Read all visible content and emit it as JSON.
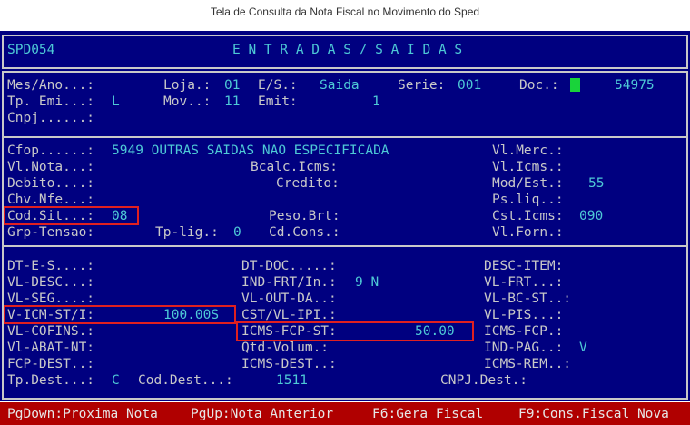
{
  "caption": "Tela de Consulta da Nota Fiscal no Movimento do Sped",
  "header": {
    "program": "SPD054",
    "title": "E N T R A D A S / S A I D A S"
  },
  "section1": {
    "mes_ano": "Mes/Ano...:",
    "loja_label": "Loja.:",
    "loja_value": "01",
    "es_label": "E/S.:",
    "es_value": "Saida",
    "serie_label": "Serie:",
    "serie_value": "001",
    "doc_label": "Doc.:",
    "doc_value": "54975",
    "tp_emi_label": "Tp. Emi...:",
    "tp_emi_value": "L",
    "mov_label": "Mov..:",
    "mov_value": "11",
    "emit_label": "Emit:",
    "emit_value": "1",
    "cnpj_label": "Cnpj......:"
  },
  "section2": {
    "cfop_label": "Cfop......:",
    "cfop_value": "5949 OUTRAS SAIDAS NAO ESPECIFICADA",
    "vl_merc": "Vl.Merc.:",
    "vl_nota": "Vl.Nota...:",
    "bcalc_icms": "Bcalc.Icms:",
    "vl_icms": "Vl.Icms.:",
    "debito": "Debito....:",
    "credito": "Credito:",
    "mod_est_label": "Mod/Est.:",
    "mod_est_value": "55",
    "chv_nfe": "Chv.Nfe...:",
    "ps_liq": "Ps.liq..:",
    "cod_sit_label": "Cod.Sit...:",
    "cod_sit_value": "08",
    "peso_brt": "Peso.Brt:",
    "cst_icms_label": "Cst.Icms:",
    "cst_icms_value": "090",
    "grp_tensao": "Grp-Tensao:",
    "tp_lig_label": "Tp-lig.:",
    "tp_lig_value": "0",
    "cd_cons": "Cd.Cons.:",
    "vl_forn": "Vl.Forn.:"
  },
  "section3": {
    "dt_e_s": "DT-E-S....:",
    "dt_doc": "DT-DOC.....:",
    "desc_item": "DESC-ITEM:",
    "vl_desc": "VL-DESC...:",
    "ind_frt_label": "IND-FRT/In.:",
    "ind_frt_value": "9 N",
    "vl_frt": "VL-FRT...:",
    "vl_seg": "VL-SEG....:",
    "vl_out_da": "VL-OUT-DA..:",
    "vl_bc_st": "VL-BC-ST..:",
    "v_icm_st_label": "V-ICM-ST/I:",
    "v_icm_st_value": "100.00S",
    "cst_vl_ipi": "CST/VL-IPI.:",
    "vl_pis": "VL-PIS...:",
    "vl_cofins": "VL-COFINS.:",
    "icms_fcp_st_label": "ICMS-FCP-ST:",
    "icms_fcp_st_value": "50.00",
    "icms_fcp": "ICMS-FCP.:",
    "vl_abat_nt": "Vl-ABAT-NT:",
    "qtd_volum": "Qtd-Volum.:",
    "ind_pag_label": "IND-PAG..:",
    "ind_pag_value": "V",
    "fcp_dest": "FCP-DEST..:",
    "icms_dest": "ICMS-DEST..:",
    "icms_rem": "ICMS-REM..:",
    "tp_dest_label": "Tp.Dest...:",
    "tp_dest_value": "C",
    "cod_dest_label": "Cod.Dest...:",
    "cod_dest_value": "1511",
    "cnpj_dest": "CNPJ.Dest.:"
  },
  "footer": {
    "pgdown": "PgDown:Proxima Nota",
    "pgup": "PgUp:Nota Anterior",
    "f6": "F6:Gera Fiscal",
    "f9": "F9:Cons.Fiscal Nova"
  },
  "colors": {
    "background": "#000080",
    "label": "#c8c8c8",
    "value": "#4ec9d6",
    "highlight": "#e02020",
    "cursor": "#19d33a",
    "footer": "#b00000"
  }
}
